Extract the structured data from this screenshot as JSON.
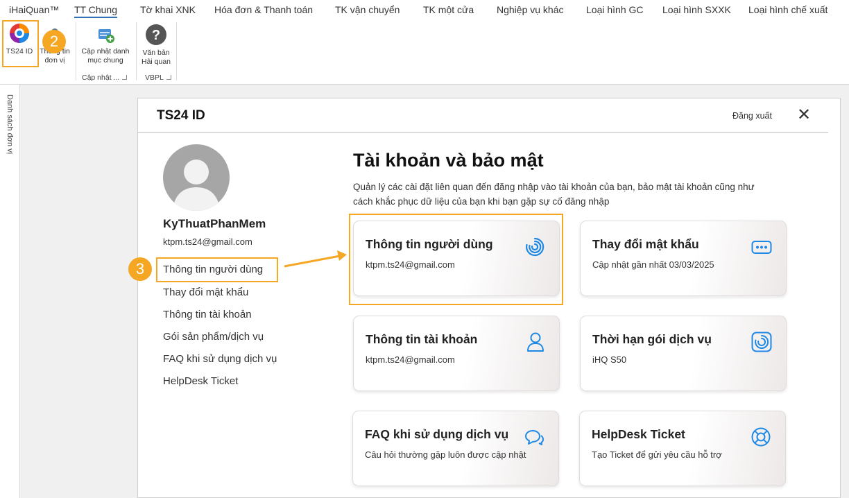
{
  "menu": {
    "items": [
      "iHaiQuan™",
      "TT Chung",
      "Tờ khai XNK",
      "Hóa đơn & Thanh toán",
      "TK vận chuyển",
      "TK một cửa",
      "Nghiệp vụ khác",
      "Loại hình GC",
      "Loại hình SXXK",
      "Loại hình chế xuất"
    ],
    "active": "TT Chung"
  },
  "ribbon": {
    "ts24id_label": "TS24 ID",
    "company_info_line1": "Thông tin",
    "company_info_line2": "đơn vị",
    "update_catalog_line1": "Cập nhật danh",
    "update_catalog_line2": "mục chung",
    "docs_line1": "Văn bản",
    "docs_line2": "Hải quan",
    "group_update": "Cập nhật ...",
    "group_vbpl": "VBPL"
  },
  "side_strip": {
    "label": "Danh sách đơn vị"
  },
  "dialog": {
    "title": "TS24 ID",
    "logout_label": "Đăng xuất",
    "close_symbol": "✕",
    "user": {
      "name": "KyThuatPhanMem",
      "email": "ktpm.ts24@gmail.com"
    },
    "nav": [
      "Thông tin người dùng",
      "Thay đổi mật khẩu",
      "Thông tin tài khoản",
      "Gói sản phẩm/dịch vụ",
      "FAQ khi sử dụng dịch vụ",
      "HelpDesk Ticket"
    ],
    "heading": "Tài khoản và bảo mật",
    "description": "Quản lý các cài đặt liên quan đến đăng nhập vào tài khoản của bạn, bảo mật tài khoản cũng như cách khắc phục dữ liệu của bạn khi bạn gặp sự cố đăng nhập",
    "cards": [
      {
        "title": "Thông tin người dùng",
        "subtitle": "ktpm.ts24@gmail.com",
        "icon": "spiral-logo-icon"
      },
      {
        "title": "Thay đổi mật khẩu",
        "subtitle": "Cập nhật gần nhất 03/03/2025",
        "icon": "password-dots-icon"
      },
      {
        "title": "Thông tin tài khoản",
        "subtitle": "ktpm.ts24@gmail.com",
        "icon": "user-icon"
      },
      {
        "title": "Thời hạn gói dịch vụ",
        "subtitle": "iHQ S50",
        "icon": "service-box-icon"
      },
      {
        "title": "FAQ khi sử dụng dịch vụ",
        "subtitle": "Câu hỏi thường gặp luôn được cập nhật",
        "icon": "chat-bubbles-icon"
      },
      {
        "title": "HelpDesk Ticket",
        "subtitle": "Tạo Ticket để gửi yêu cầu hỗ trợ",
        "icon": "lifebuoy-icon"
      }
    ]
  },
  "annotations": {
    "step2": "2",
    "step3": "3"
  },
  "colors": {
    "accent_orange": "#f5a623",
    "icon_blue": "#1e88e5",
    "tab_underline": "#2f6fb3"
  }
}
